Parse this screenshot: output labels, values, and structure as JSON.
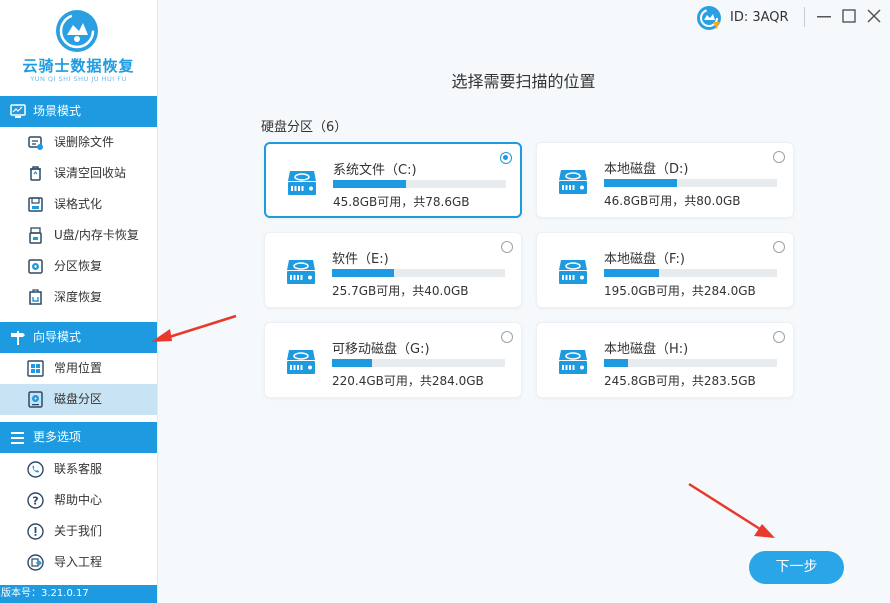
{
  "app": {
    "brand": "云骑士数据恢复",
    "brand_sub": "YUN QI SHI SHU JU HUI FU",
    "version": "版本号：3.21.0.17"
  },
  "titlebar": {
    "user_id": "ID: 3AQR"
  },
  "sidebar": {
    "sections": [
      {
        "label": "场景模式",
        "items": [
          {
            "label": "误删除文件",
            "icon": "deleted-file-icon"
          },
          {
            "label": "误清空回收站",
            "icon": "recycle-bin-icon"
          },
          {
            "label": "误格式化",
            "icon": "format-disk-icon"
          },
          {
            "label": "U盘/内存卡恢复",
            "icon": "usb-drive-icon"
          },
          {
            "label": "分区恢复",
            "icon": "partition-icon"
          },
          {
            "label": "深度恢复",
            "icon": "deep-scan-icon"
          }
        ]
      },
      {
        "label": "向导模式",
        "items": [
          {
            "label": "常用位置",
            "icon": "windows-icon"
          },
          {
            "label": "磁盘分区",
            "icon": "disk-icon",
            "active": true
          }
        ]
      },
      {
        "label": "更多选项",
        "items": [
          {
            "label": "联系客服",
            "icon": "phone-icon"
          },
          {
            "label": "帮助中心",
            "icon": "question-icon"
          },
          {
            "label": "关于我们",
            "icon": "info-icon"
          },
          {
            "label": "导入工程",
            "icon": "import-icon"
          }
        ]
      }
    ]
  },
  "main": {
    "title": "选择需要扫描的位置",
    "partition_header": "硬盘分区（6）",
    "drives": [
      {
        "name": "系统文件（C:)",
        "size": "45.8GB可用，共78.6GB",
        "used_fraction": 0.42,
        "selected": true
      },
      {
        "name": "本地磁盘（D:)",
        "size": "46.8GB可用，共80.0GB",
        "used_fraction": 0.42,
        "selected": false
      },
      {
        "name": "软件（E:)",
        "size": "25.7GB可用，共40.0GB",
        "used_fraction": 0.36,
        "selected": false
      },
      {
        "name": "本地磁盘（F:)",
        "size": "195.0GB可用，共284.0GB",
        "used_fraction": 0.32,
        "selected": false
      },
      {
        "name": "可移动磁盘（G:)",
        "size": "220.4GB可用，共284.0GB",
        "used_fraction": 0.23,
        "selected": false
      },
      {
        "name": "本地磁盘（H:)",
        "size": "245.8GB可用，共283.5GB",
        "used_fraction": 0.14,
        "selected": false
      }
    ],
    "next_label": "下一步"
  },
  "colors": {
    "accent": "#1d9ae0",
    "active_bg": "#c8e4f4",
    "arrow": "#e8392c"
  }
}
